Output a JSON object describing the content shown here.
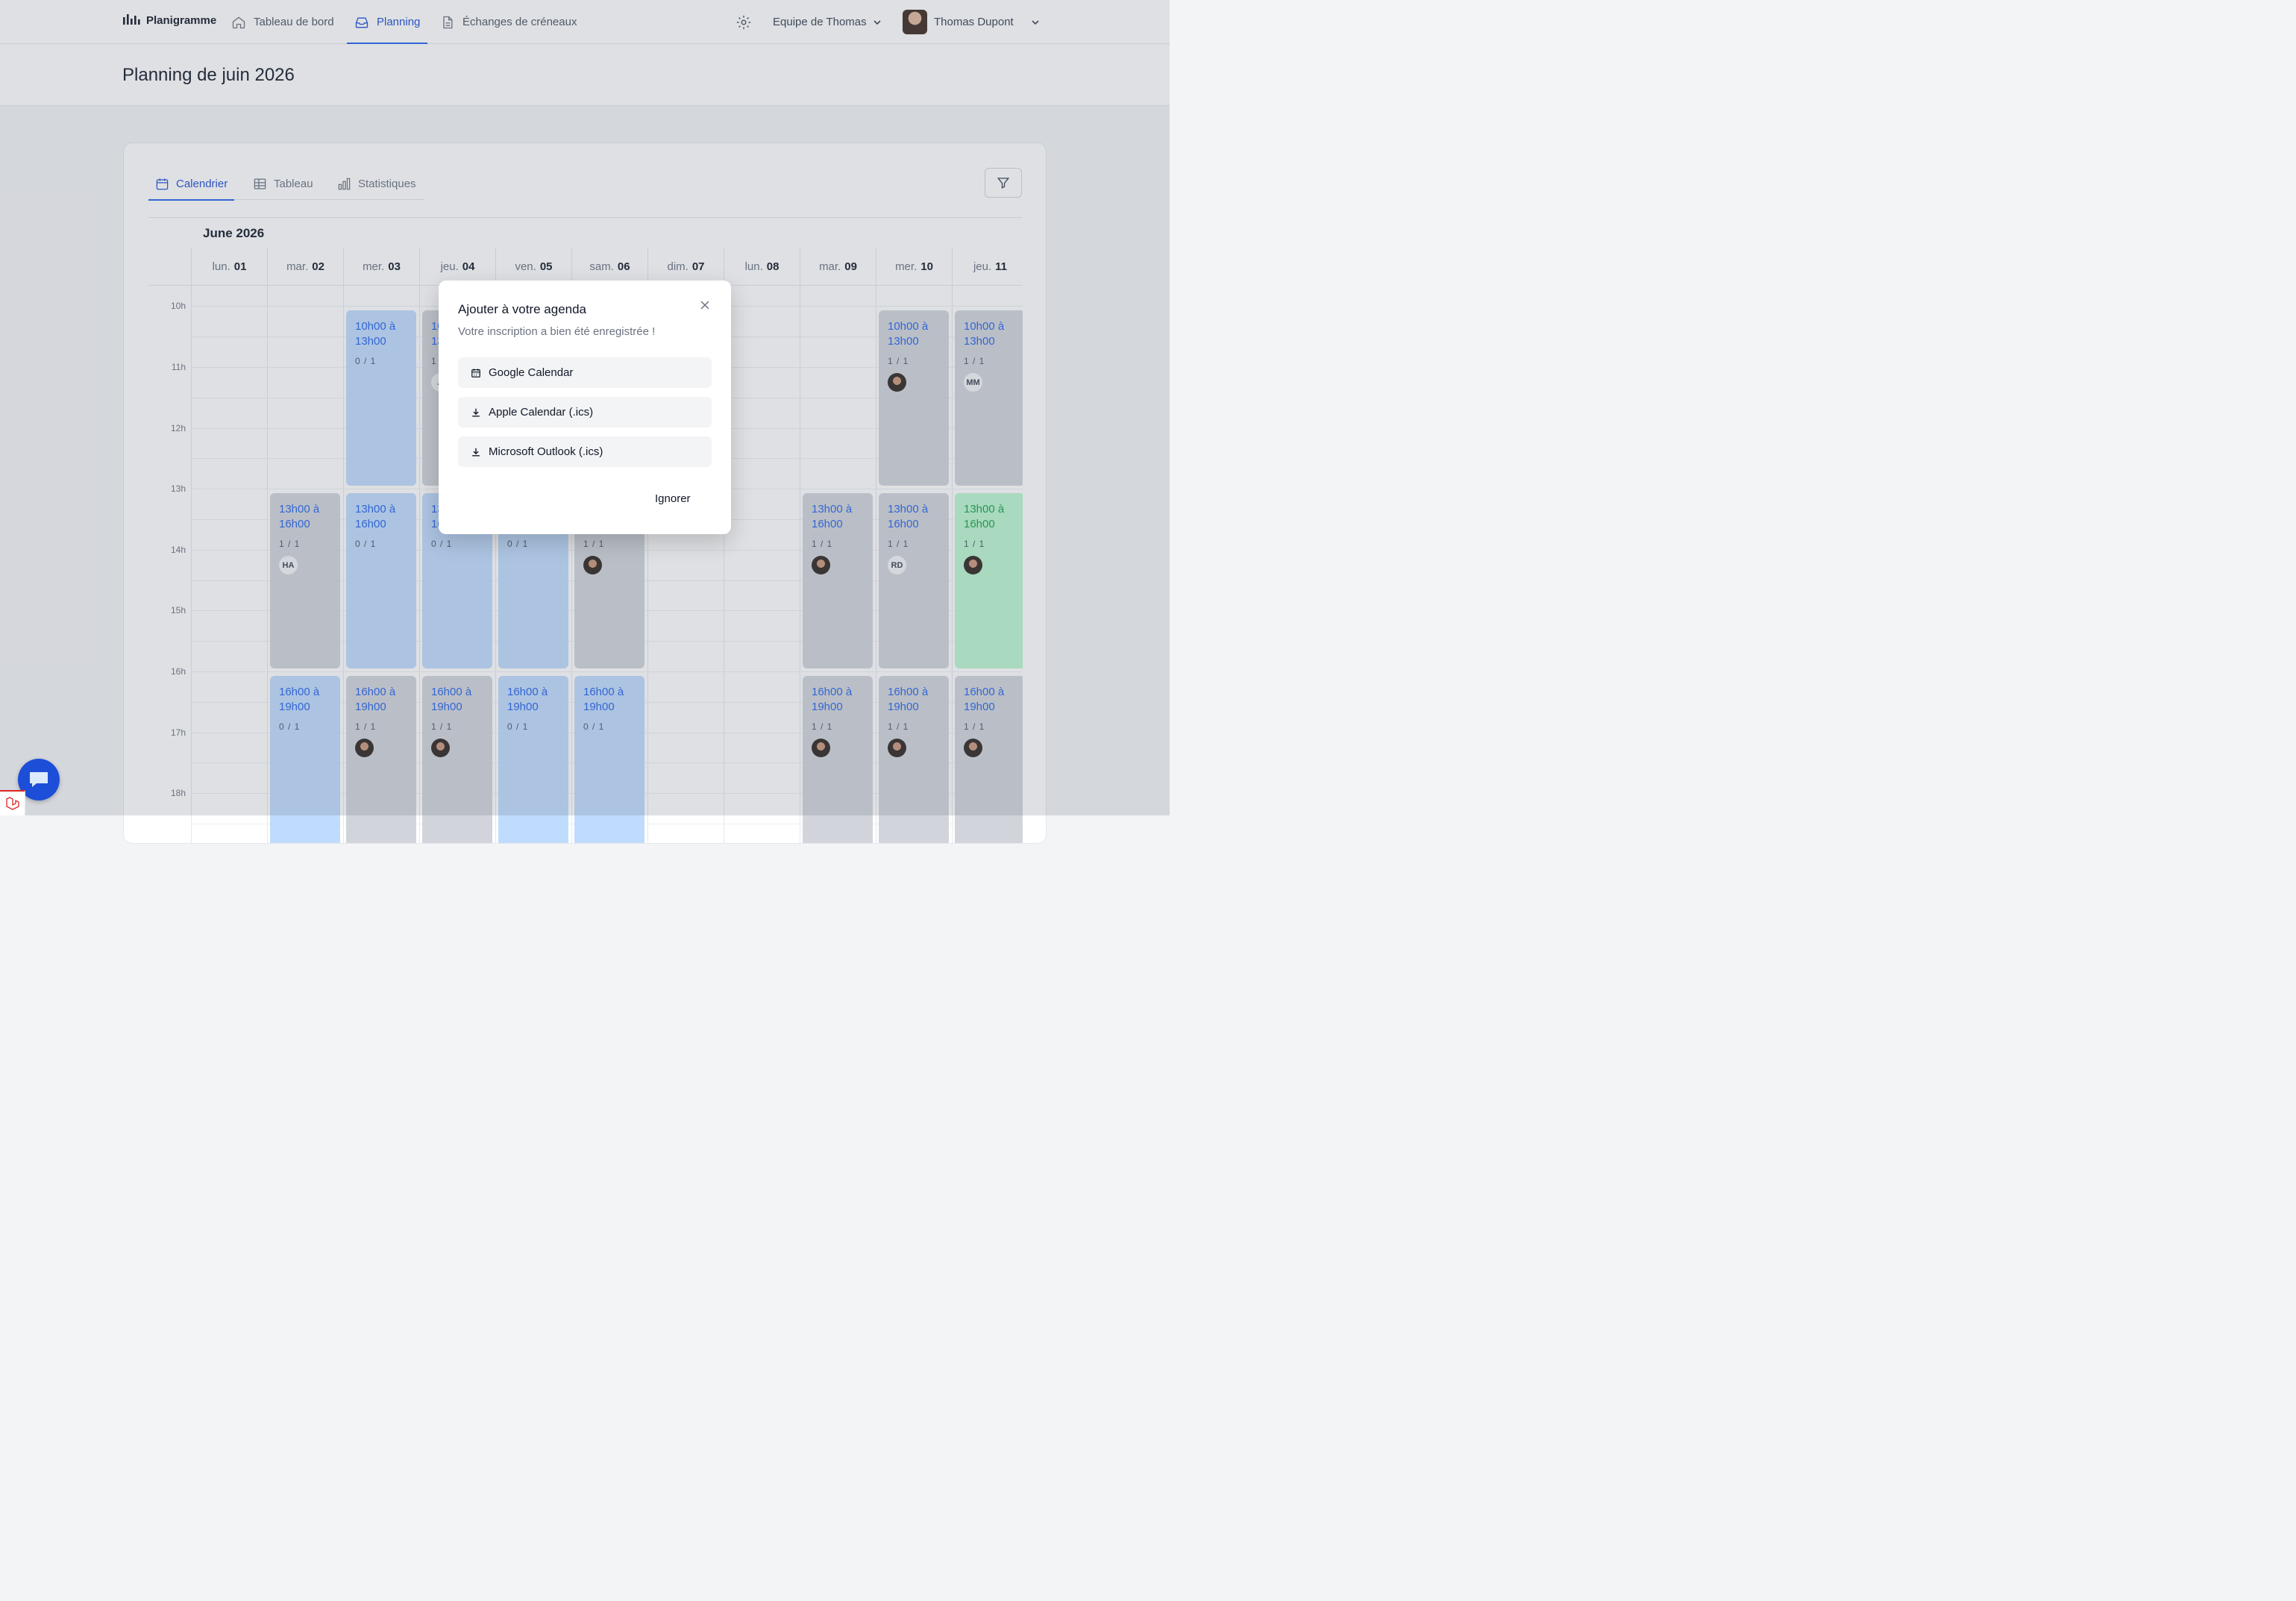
{
  "header": {
    "brand": "Planigramme",
    "nav": [
      {
        "label": "Tableau de bord",
        "icon": "home-icon"
      },
      {
        "label": "Planning",
        "icon": "inbox-icon"
      },
      {
        "label": "Échanges de créneaux",
        "icon": "document-icon"
      }
    ],
    "team": "Equipe de Thomas",
    "user": "Thomas Dupont"
  },
  "page": {
    "title": "Planning de juin 2026"
  },
  "tabs": [
    {
      "label": "Calendrier",
      "icon": "calendar-icon"
    },
    {
      "label": "Tableau",
      "icon": "table-icon"
    },
    {
      "label": "Statistiques",
      "icon": "chart-icon"
    }
  ],
  "calendar": {
    "month": "June 2026",
    "days": [
      {
        "dow": "lun.",
        "num": "01"
      },
      {
        "dow": "mar.",
        "num": "02"
      },
      {
        "dow": "mer.",
        "num": "03"
      },
      {
        "dow": "jeu.",
        "num": "04"
      },
      {
        "dow": "ven.",
        "num": "05"
      },
      {
        "dow": "sam.",
        "num": "06"
      },
      {
        "dow": "dim.",
        "num": "07"
      },
      {
        "dow": "lun.",
        "num": "08"
      },
      {
        "dow": "mar.",
        "num": "09"
      },
      {
        "dow": "mer.",
        "num": "10"
      },
      {
        "dow": "jeu.",
        "num": "11"
      }
    ],
    "hours": [
      "10h",
      "11h",
      "12h",
      "13h",
      "14h",
      "15h",
      "16h",
      "17h",
      "18h"
    ],
    "shifts": [
      {
        "day": 2,
        "slot": 0,
        "time": "10h00 à 13h00",
        "count": "0 / 1",
        "status": "open"
      },
      {
        "day": 3,
        "slot": 0,
        "time": "10h00 à 13h00",
        "count": "1 / 1",
        "status": "full",
        "avatar": "A"
      },
      {
        "day": 9,
        "slot": 0,
        "time": "10h00 à 13h00",
        "count": "1 / 1",
        "status": "full",
        "avatar": "photo"
      },
      {
        "day": 10,
        "slot": 0,
        "time": "10h00 à 13h00",
        "count": "1 / 1",
        "status": "full",
        "avatar": "MM"
      },
      {
        "day": 1,
        "slot": 1,
        "time": "13h00 à 16h00",
        "count": "1 / 1",
        "status": "full",
        "avatar": "HA"
      },
      {
        "day": 2,
        "slot": 1,
        "time": "13h00 à 16h00",
        "count": "0 / 1",
        "status": "open"
      },
      {
        "day": 3,
        "slot": 1,
        "time": "13h00 à 16h00",
        "count": "0 / 1",
        "status": "open"
      },
      {
        "day": 4,
        "slot": 1,
        "time": "13h00 à 16h00",
        "count": "0 / 1",
        "status": "open"
      },
      {
        "day": 5,
        "slot": 1,
        "time": "13h00 à 16h00",
        "count": "1 / 1",
        "status": "full",
        "avatar": "photo"
      },
      {
        "day": 8,
        "slot": 1,
        "time": "13h00 à 16h00",
        "count": "1 / 1",
        "status": "full",
        "avatar": "photo"
      },
      {
        "day": 9,
        "slot": 1,
        "time": "13h00 à 16h00",
        "count": "1 / 1",
        "status": "full",
        "avatar": "RD"
      },
      {
        "day": 10,
        "slot": 1,
        "time": "13h00 à 16h00",
        "count": "1 / 1",
        "status": "mine",
        "avatar": "photo"
      },
      {
        "day": 1,
        "slot": 2,
        "time": "16h00 à 19h00",
        "count": "0 / 1",
        "status": "open"
      },
      {
        "day": 2,
        "slot": 2,
        "time": "16h00 à 19h00",
        "count": "1 / 1",
        "status": "full",
        "avatar": "photo"
      },
      {
        "day": 3,
        "slot": 2,
        "time": "16h00 à 19h00",
        "count": "1 / 1",
        "status": "full",
        "avatar": "photo"
      },
      {
        "day": 4,
        "slot": 2,
        "time": "16h00 à 19h00",
        "count": "0 / 1",
        "status": "open"
      },
      {
        "day": 5,
        "slot": 2,
        "time": "16h00 à 19h00",
        "count": "0 / 1",
        "status": "open"
      },
      {
        "day": 8,
        "slot": 2,
        "time": "16h00 à 19h00",
        "count": "1 / 1",
        "status": "full",
        "avatar": "photo"
      },
      {
        "day": 9,
        "slot": 2,
        "time": "16h00 à 19h00",
        "count": "1 / 1",
        "status": "full",
        "avatar": "photo"
      },
      {
        "day": 10,
        "slot": 2,
        "time": "16h00 à 19h00",
        "count": "1 / 1",
        "status": "full",
        "avatar": "photo"
      }
    ]
  },
  "modal": {
    "title": "Ajouter à votre agenda",
    "subtitle": "Votre inscription a bien été enregistrée !",
    "options": [
      {
        "label": "Google Calendar",
        "icon": "calendar-icon"
      },
      {
        "label": "Apple Calendar (.ics)",
        "icon": "download-icon"
      },
      {
        "label": "Microsoft Outlook (.ics)",
        "icon": "download-icon"
      }
    ],
    "dismiss": "Ignorer"
  },
  "colors": {
    "accent": "#2563eb",
    "open_shift": "#bfdbfe",
    "full_shift": "#d1d5db",
    "my_shift": "#bbf7d0"
  }
}
